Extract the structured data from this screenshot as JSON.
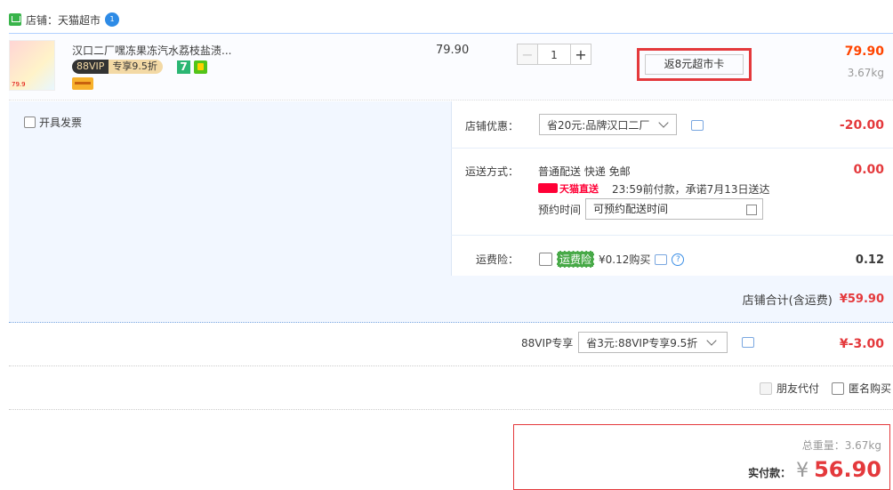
{
  "shop": {
    "label": "店铺：天猫超市"
  },
  "item": {
    "title": "汉口二厂嘿冻果冻汽水荔枝盐渍...",
    "vip_prefix": "88VIP",
    "vip_discount": "专享9.5折",
    "badge_7": "7",
    "thumb_price": "79.9",
    "unit_price": "79.90",
    "quantity": "1",
    "minus": "−",
    "plus": "+",
    "rebate": "返8元超市卡",
    "total": "79.90",
    "weight": "3.67kg"
  },
  "invoice": {
    "label": "开具发票"
  },
  "shop_discount": {
    "label": "店铺优惠：",
    "selected": "省20元:品牌汉口二厂",
    "amount": "-20.00"
  },
  "delivery": {
    "label": "运送方式：",
    "method": "普通配送 快递 免邮",
    "amount": "0.00",
    "tag": "天猫直送",
    "promise": "23:59前付款，承诺7月13日送达",
    "schedule_label": "预约时间",
    "schedule_placeholder": "可预约配送时间"
  },
  "insurance": {
    "label": "运费险：",
    "tag": "运费险",
    "price": "¥0.12购买",
    "help": "?",
    "amount": "0.12"
  },
  "shop_total": {
    "label": "店铺合计(含运费)",
    "value": "¥59.90"
  },
  "vip": {
    "label": "88VIP专享",
    "selected": "省3元:88VIP专享9.5折",
    "amount": "¥-3.00"
  },
  "options": {
    "friend_pay": "朋友代付",
    "anonymous": "匿名购买"
  },
  "summary": {
    "weight": "总重量：3.67kg",
    "pay_label": "实付款：",
    "currency": "¥",
    "pay_value": "56.90"
  },
  "colors": {
    "accent_red": "#e4393c",
    "tmall_red": "#ff0036",
    "shop_green": "#38b44a",
    "link_blue": "#2e8be6"
  }
}
